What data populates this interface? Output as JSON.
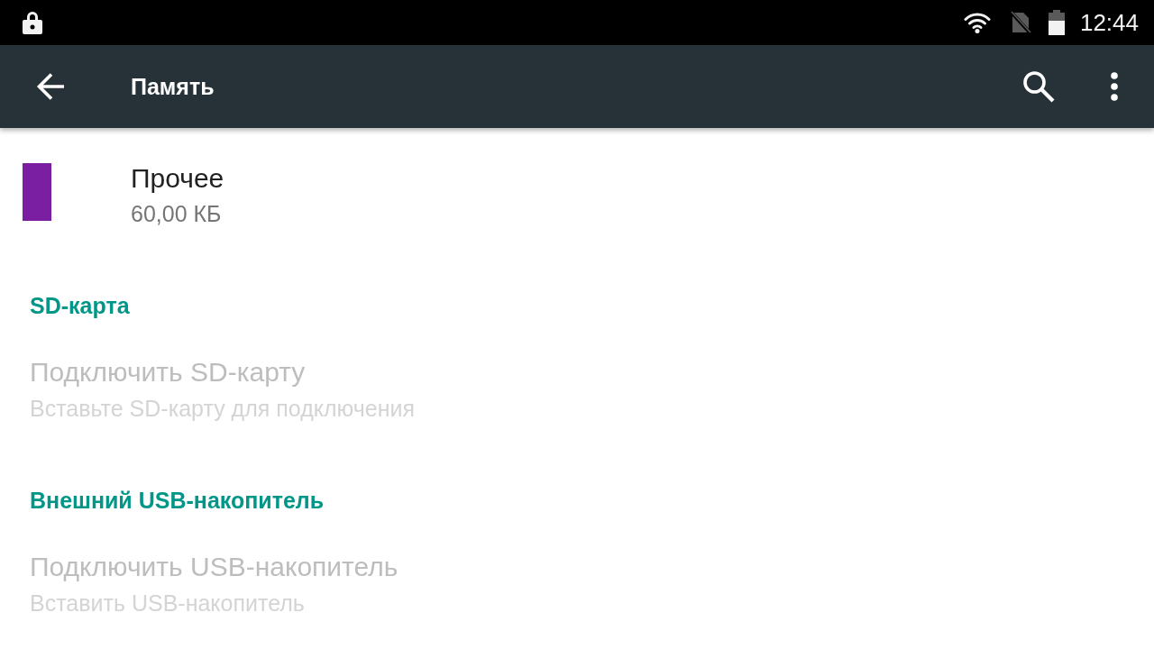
{
  "status_bar": {
    "time": "12:44"
  },
  "app_bar": {
    "title": "Память"
  },
  "storage_items": [
    {
      "label": "Прочее",
      "size": "60,00 КБ",
      "color": "#7b1fa2"
    }
  ],
  "sections": [
    {
      "header": "SD-карта",
      "items": [
        {
          "title": "Подключить SD-карту",
          "summary": "Вставьте SD-карту для подключения",
          "disabled": true
        }
      ]
    },
    {
      "header": "Внешний USB-накопитель",
      "items": [
        {
          "title": "Подключить USB-накопитель",
          "summary": "Вставить USB-накопитель",
          "disabled": true
        }
      ]
    }
  ]
}
